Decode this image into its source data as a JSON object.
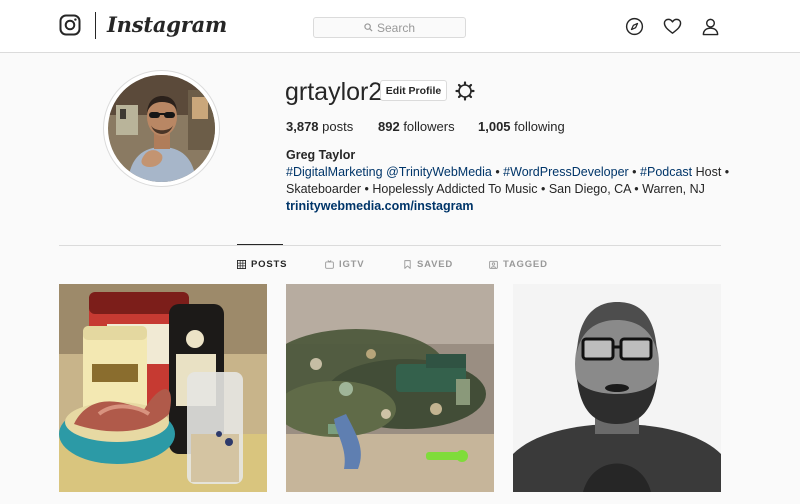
{
  "nav": {
    "logo_icon": "instagram-glyph-icon",
    "wordmark": "Instagram",
    "search_placeholder": "Search",
    "icons": [
      "compass-icon",
      "heart-icon",
      "person-icon"
    ]
  },
  "profile": {
    "username": "grtaylor2",
    "edit_label": "Edit Profile",
    "stats": {
      "posts_count": "3,878",
      "posts_label": " posts",
      "followers_count": "892",
      "followers_label": " followers",
      "following_count": "1,005",
      "following_label": " following"
    },
    "full_name": "Greg Taylor",
    "bio_line1": {
      "tag1": "#DigitalMarketing",
      "mention": "@TrinityWebMedia",
      "sep1": " • ",
      "tag2": "#WordPressDeveloper",
      "sep2": " • ",
      "tag3": "#Podcast",
      "tail": " Host •"
    },
    "bio_line2": "Skateboarder • Hopelessly Addicted To Music • San Diego, CA • Warren, NJ",
    "website": "trinitywebmedia.com/instagram"
  },
  "tabs": [
    {
      "label": "POSTS",
      "icon": "grid-icon",
      "active": true
    },
    {
      "label": "IGTV",
      "icon": "tv-icon",
      "active": false
    },
    {
      "label": "SAVED",
      "icon": "bookmark-icon",
      "active": false
    },
    {
      "label": "TAGGED",
      "icon": "tagged-icon",
      "active": false
    }
  ],
  "posts": [
    {
      "image": "food-photo"
    },
    {
      "image": "toy-soldiers-photo"
    },
    {
      "image": "selfie-photo"
    }
  ]
}
